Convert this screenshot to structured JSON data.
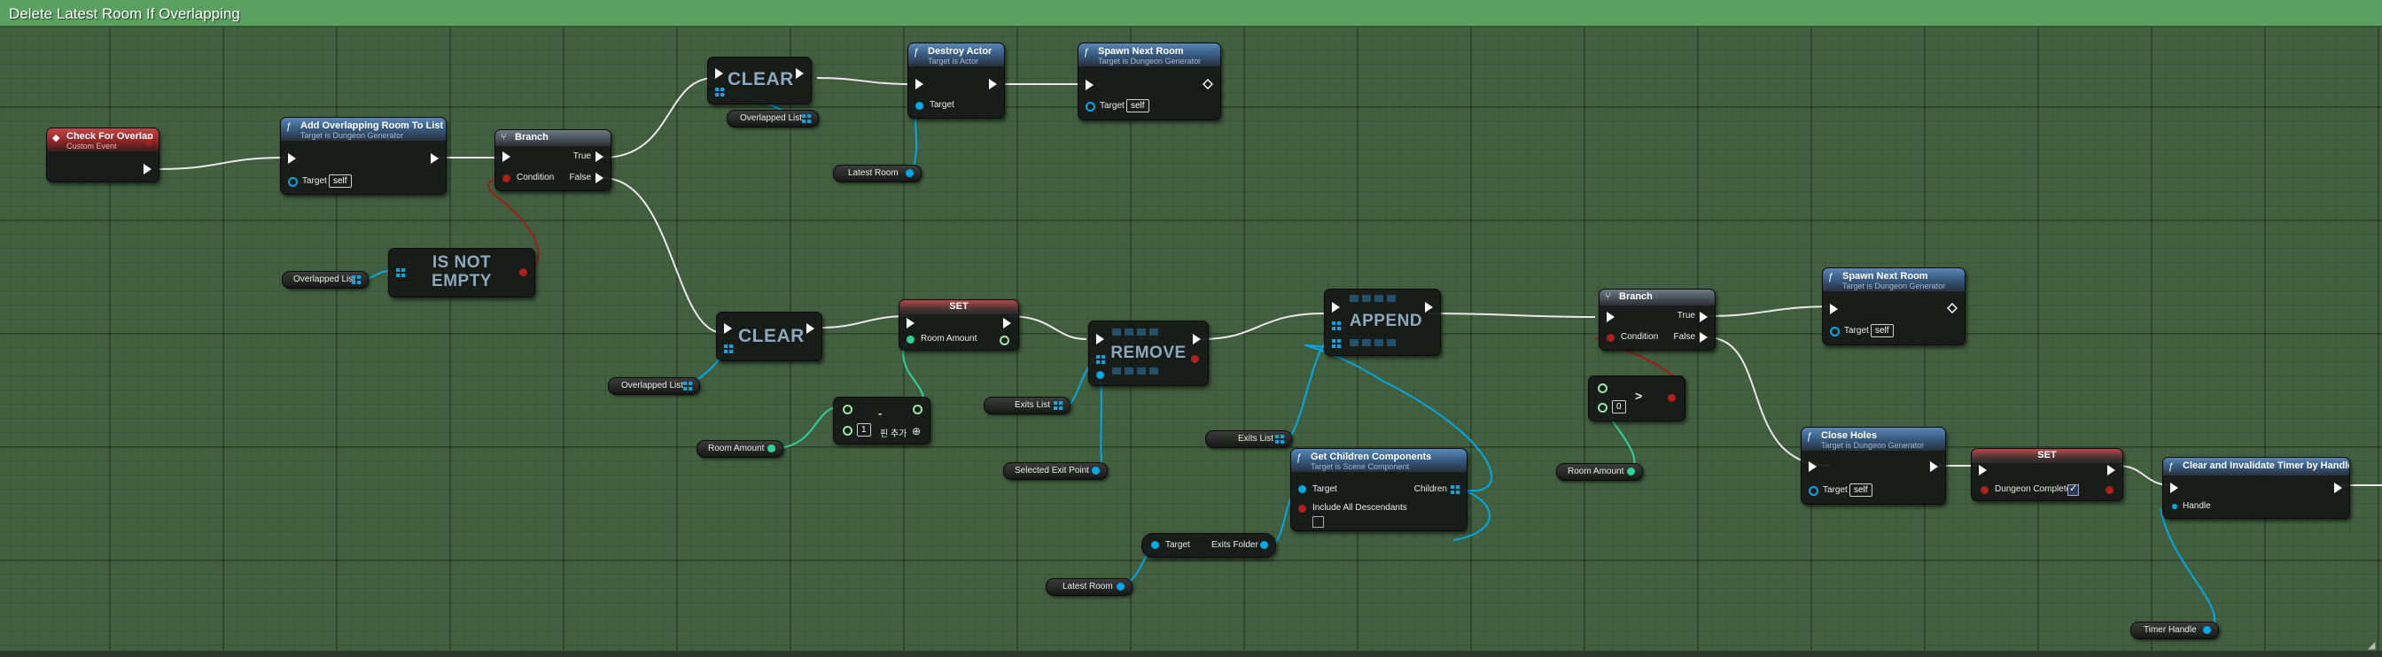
{
  "graph": {
    "title": "Delete Latest Room If Overlapping"
  },
  "nodes": {
    "check_for_overlap": {
      "title": "Check For Overlap",
      "subtitle": "Custom Event",
      "icon": "event-icon"
    },
    "add_overlapping": {
      "title": "Add Overlapping Room To List",
      "subtitle": "Target is Dungeon Generator",
      "target_label": "Target",
      "target_value": "self"
    },
    "branch1": {
      "title": "Branch",
      "true_label": "True",
      "condition_label": "Condition",
      "false_label": "False"
    },
    "is_not_empty": {
      "text_line1": "IS NOT",
      "text_line2": "EMPTY"
    },
    "clear1": {
      "text": "CLEAR"
    },
    "destroy_actor": {
      "title": "Destroy Actor",
      "subtitle": "Target is Actor",
      "target_label": "Target"
    },
    "spawn_next_room1": {
      "title": "Spawn Next Room",
      "subtitle": "Target is Dungeon Generator",
      "target_label": "Target",
      "target_value": "self"
    },
    "clear2": {
      "text": "CLEAR"
    },
    "set_room_amount": {
      "title": "SET",
      "pin_label": "Room Amount"
    },
    "minus_node": {
      "operator": "-",
      "value": "1",
      "add_pin_label": "핀 추가"
    },
    "remove": {
      "text": "REMOVE"
    },
    "append": {
      "text": "APPEND"
    },
    "get_children": {
      "title": "Get Children Components",
      "subtitle": "Target is Scene Component",
      "target_label": "Target",
      "children_label": "Children",
      "include_label": "Include All Descendants"
    },
    "break_struct": {
      "target_label": "Target",
      "exits_label": "Exits  Folder"
    },
    "branch2": {
      "title": "Branch",
      "true_label": "True",
      "condition_label": "Condition",
      "false_label": "False"
    },
    "greater": {
      "operator": ">",
      "value": "0"
    },
    "spawn_next_room2": {
      "title": "Spawn Next Room",
      "subtitle": "Target is Dungeon Generator",
      "target_label": "Target",
      "target_value": "self"
    },
    "close_holes": {
      "title": "Close Holes",
      "subtitle": "Target is Dungeon Generator",
      "target_label": "Target",
      "target_value": "self"
    },
    "set_dungeon_complete": {
      "title": "SET",
      "pin_label": "Dungeon Complete",
      "checked": true
    },
    "clear_timer": {
      "title": "Clear and Invalidate Timer by Handle",
      "handle_label": "Handle"
    }
  },
  "variables": {
    "overlapped_list_top": "Overlapped List",
    "latest_room_top": "Latest Room",
    "overlapped_list_left": "Overlapped List",
    "overlapped_list_mid": "Overlapped List",
    "room_amount_1": "Room Amount",
    "exits_list_1": "Exits List",
    "selected_exit_point": "Selected Exit Point",
    "exits_list_2": "Exits List",
    "latest_room_bottom": "Latest Room",
    "room_amount_2": "Room Amount",
    "timer_handle": "Timer Handle"
  },
  "colors": {
    "exec_wire": "#e8e8e8",
    "object_wire": "#00a8e6",
    "bool_wire": "#a01b1b",
    "int_wire": "#2fd19a",
    "title_bar": "#5aa060",
    "graph_bg": "#42603f"
  }
}
